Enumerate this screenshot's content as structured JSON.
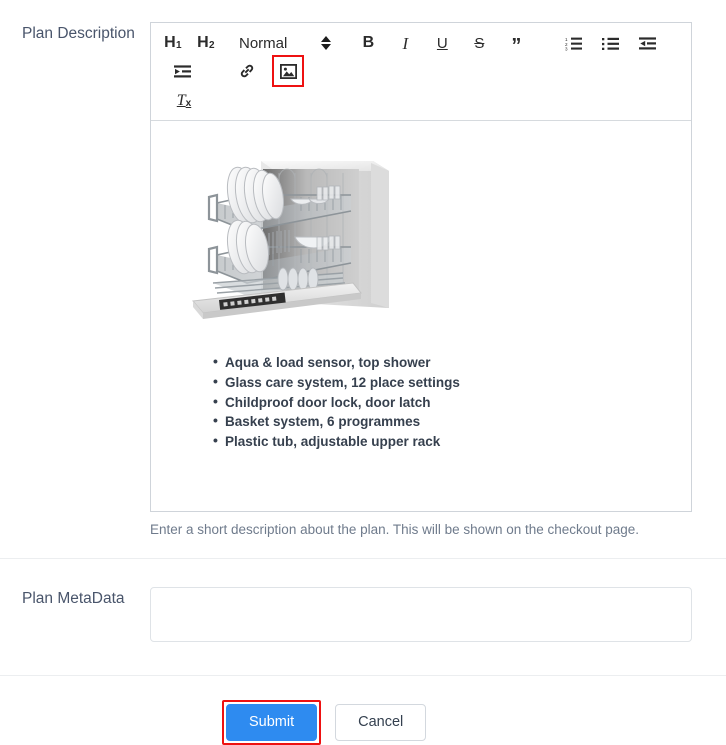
{
  "form": {
    "description_field": {
      "label": "Plan Description",
      "help_text": "Enter a short description about the plan. This will be shown on the checkout page."
    },
    "metadata_field": {
      "label": "Plan MetaData",
      "value": "",
      "placeholder": ""
    }
  },
  "editor": {
    "toolbar": {
      "heading1": {
        "text": "H",
        "sub": "1",
        "icon": "heading-1-icon"
      },
      "heading2": {
        "text": "H",
        "sub": "2",
        "icon": "heading-2-icon"
      },
      "block_format": {
        "selected": "Normal",
        "icon": "updown-arrows-icon"
      },
      "bold": {
        "label": "B",
        "icon": "bold-icon"
      },
      "italic": {
        "label": "I",
        "icon": "italic-icon"
      },
      "underline": {
        "label": "U",
        "icon": "underline-icon"
      },
      "strikethrough": {
        "label": "S",
        "icon": "strikethrough-icon"
      },
      "blockquote": {
        "label": "”",
        "icon": "blockquote-icon"
      },
      "ordered_list": {
        "icon": "ordered-list-icon"
      },
      "bullet_list": {
        "icon": "bullet-list-icon"
      },
      "outdent": {
        "icon": "outdent-icon"
      },
      "indent": {
        "icon": "indent-icon"
      },
      "link": {
        "icon": "link-icon"
      },
      "image": {
        "icon": "image-icon",
        "highlighted": true
      },
      "clear_format": {
        "text": "T",
        "sub": "x",
        "icon": "clear-formatting-icon"
      }
    },
    "content": {
      "image_alt": "dishwasher-product-image",
      "features": [
        "Aqua & load sensor, top shower",
        "Glass care system, 12 place settings",
        "Childproof door lock, door latch",
        "Basket system, 6 programmes",
        "Plastic tub, adjustable upper rack"
      ]
    }
  },
  "actions": {
    "submit": {
      "label": "Submit",
      "highlighted": true
    },
    "cancel": {
      "label": "Cancel"
    }
  },
  "colors": {
    "primary": "#2e8bf0",
    "highlight": "#ee1111",
    "label_text": "#49556b",
    "help_text": "#6f7b8c",
    "border": "#cfd4da"
  }
}
